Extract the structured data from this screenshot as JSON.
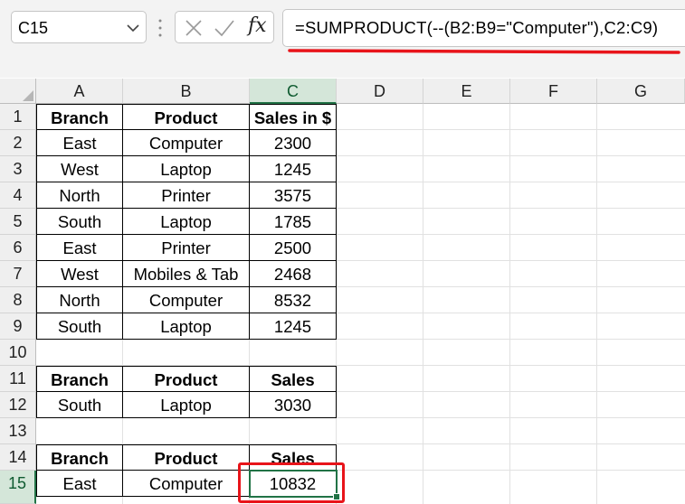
{
  "name_box": {
    "value": "C15"
  },
  "formula_bar": {
    "fx_label": "fx",
    "formula": "=SUMPRODUCT(--(B2:B9=\"Computer\"),C2:C9)"
  },
  "columns": [
    "A",
    "B",
    "C",
    "D",
    "E",
    "F",
    "G"
  ],
  "selected_column": "C",
  "rows": [
    "1",
    "2",
    "3",
    "4",
    "5",
    "6",
    "7",
    "8",
    "9",
    "10",
    "11",
    "12",
    "13",
    "14",
    "15"
  ],
  "selected_row": "15",
  "table_main": {
    "headers": [
      "Branch",
      "Product",
      "Sales in $"
    ],
    "rows": [
      [
        "East",
        "Computer",
        "2300"
      ],
      [
        "West",
        "Laptop",
        "1245"
      ],
      [
        "North",
        "Printer",
        "3575"
      ],
      [
        "South",
        "Laptop",
        "1785"
      ],
      [
        "East",
        "Printer",
        "2500"
      ],
      [
        "West",
        "Mobiles & Tab",
        "2468"
      ],
      [
        "North",
        "Computer",
        "8532"
      ],
      [
        "South",
        "Laptop",
        "1245"
      ]
    ]
  },
  "table_result1": {
    "headers": [
      "Branch",
      "Product",
      "Sales"
    ],
    "row": [
      "South",
      "Laptop",
      "3030"
    ]
  },
  "table_result2": {
    "headers": [
      "Branch",
      "Product",
      "Sales"
    ],
    "row": [
      "East",
      "Computer",
      "10832"
    ]
  },
  "colors": {
    "accent": "#217346",
    "highlight_red": "#e8141a"
  }
}
